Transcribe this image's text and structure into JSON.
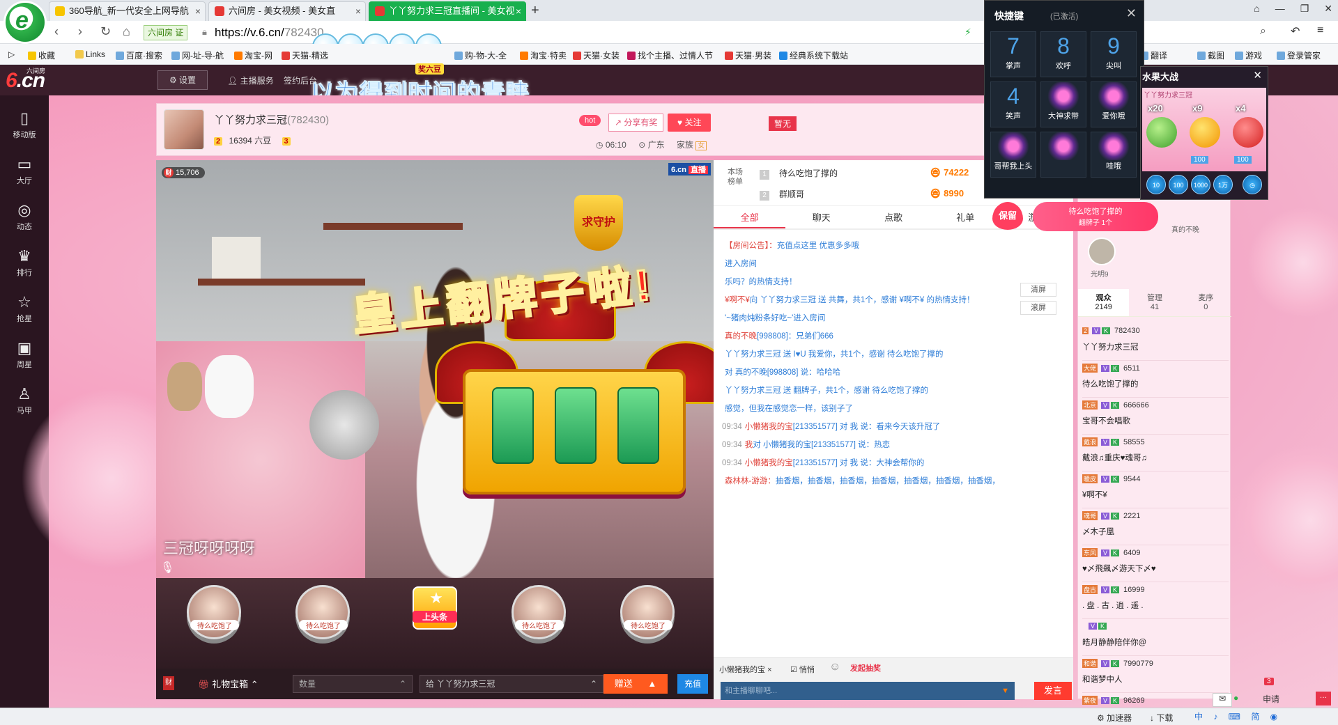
{
  "browser": {
    "tabs": [
      {
        "title": "360导航_新一代安全上网导航",
        "color": "#f7c500"
      },
      {
        "title": "六间房 - 美女视频 - 美女直",
        "color": "#e53935"
      },
      {
        "title": "丫丫努力求三冠直播间 - 美女视",
        "color": "#e53935"
      }
    ],
    "site_badge": "六间房 证",
    "url_host": "https://v.6.cn/",
    "url_path": "782430",
    "bookmarks": [
      "收藏",
      "Links",
      "百度·搜索",
      "网-址-导-航",
      "淘宝-网",
      "天猫-精选",
      "购-物-大-全",
      "淘宝·特卖",
      "天猫·女装",
      "找个主播、过情人节",
      "天猫·男装",
      "经典系统下载站",
      "翻译",
      "截图",
      "游戏",
      "登录管家"
    ]
  },
  "site": {
    "brand_sub": "六间房",
    "brand": "6.cn",
    "settings": "设置",
    "links": [
      "主播服务",
      "签约后台"
    ],
    "caption": "以为得到时间的青睐",
    "prize_badge": "奖六豆"
  },
  "leftnav": [
    {
      "icon": "phone-icon",
      "glyph": "▯",
      "label": "移动版"
    },
    {
      "icon": "tv-icon",
      "glyph": "▭",
      "label": "大厅"
    },
    {
      "icon": "compass-icon",
      "glyph": "◎",
      "label": "动态"
    },
    {
      "icon": "crown-icon",
      "glyph": "♛",
      "label": "排行"
    },
    {
      "icon": "star-icon",
      "glyph": "☆",
      "label": "抢星"
    },
    {
      "icon": "calendar-icon",
      "glyph": "▣",
      "label": "周星"
    },
    {
      "icon": "shirt-icon",
      "glyph": "♙",
      "label": "马甲"
    }
  ],
  "room": {
    "name": "丫丫努力求三冠",
    "id": "(782430)",
    "level_a": "2",
    "beans": "16394 六豆",
    "level_b": "3",
    "hot": "hot",
    "share": "分享有奖",
    "follow": "关注",
    "time": "06:10",
    "region": "广东",
    "family": "家族",
    "family_tag": "女",
    "noflag": "暂无"
  },
  "video": {
    "fans": "15,706",
    "fans_icon": "财",
    "logo": "6.cn",
    "live": "直播",
    "overlay_title": "皇上翻牌子啦!",
    "guard_badge": "求守护",
    "caption": "三冠呀呀呀呀"
  },
  "giftstrip": {
    "heads": [
      "待么吃饱了",
      "待么吃饱了",
      "待么吃饱了",
      "待么吃饱了"
    ],
    "top_label": "上头条"
  },
  "controls": {
    "cai": "财",
    "giftbox": "礼物宝箱",
    "qty_placeholder": "数量",
    "target": "给 丫丫努力求三冠",
    "send": "赠送",
    "recharge": "充值"
  },
  "chat": {
    "rank_label": "本场榜单",
    "ranks": [
      {
        "num": "1",
        "name": "待么吃饱了撑的",
        "score": "74222"
      },
      {
        "num": "2",
        "name": "群顺哥",
        "score": "8990"
      }
    ],
    "tabs": [
      "全部",
      "聊天",
      "点歌",
      "礼单",
      "游戏"
    ],
    "clear": "清屏",
    "scroll": "滚屏",
    "messages": [
      {
        "t": "",
        "u": "【房间公告】：",
        "v": "充值点这里 优惠多多哦"
      },
      {
        "t": "",
        "u": "",
        "v": "进入房间"
      },
      {
        "t": "",
        "u": "",
        "v": "乐吗？的热情支持！"
      },
      {
        "t": "",
        "u": "¥啊不¥",
        "v": "向 丫丫努力求三冠 送 共舞，共1个，感谢 ¥啊不¥ 的热情支持！"
      },
      {
        "t": "",
        "u": "",
        "v": "'~猪肉炖粉条好吃~'进入房间"
      },
      {
        "t": "",
        "u": "真的不晚",
        "v": "[998808]：兄弟们666"
      },
      {
        "t": "",
        "u": "",
        "v": "丫丫努力求三冠 送 I♥U 我爱你，共1个，感谢 待么吃饱了撑的"
      },
      {
        "t": "",
        "u": "",
        "v": "对 真的不晚[998808] 说：哈哈哈"
      },
      {
        "t": "",
        "u": "",
        "v": "丫丫努力求三冠 送 翻牌子，共1个，感谢 待么吃饱了撑的"
      },
      {
        "t": "",
        "u": "",
        "v": "感觉，但我在感觉恋一样，该别子了"
      },
      {
        "t": "09:34",
        "u": "小懒猪我的宝",
        "v": "[213351577] 对 我 说：看来今天该升冠了"
      },
      {
        "t": "09:34",
        "u": "我",
        "v": "对 小懒猪我的宝[213351577] 说：热恋"
      },
      {
        "t": "09:34",
        "u": "小懒猪我的宝",
        "v": "[213351577] 对 我 说：大神会帮你的"
      },
      {
        "t": "",
        "u": "森林林-游游：",
        "v": "抽香烟，抽香烟，抽香烟，抽香烟，抽香烟，抽香烟，抽香烟，"
      }
    ],
    "whisper_to": "小懒猪我的宝",
    "private": "悄悄",
    "activity": "发起抽奖",
    "input_placeholder": "和主播聊聊吧...",
    "send": "发言"
  },
  "users": {
    "keep": "保留",
    "flip_line1": "待么吃饱了撑的",
    "flip_line2": "翻牌子 1个",
    "guest_a": "光明9",
    "guest_b": "真的不晚",
    "stats": [
      {
        "label": "观众",
        "value": "2149"
      },
      {
        "label": "管理",
        "value": "41"
      },
      {
        "label": "麦序",
        "value": "0"
      }
    ],
    "list": [
      {
        "id": "782430",
        "name": "丫丫努力求三冠",
        "tag": "2"
      },
      {
        "id": "6511",
        "name": "待么吃饱了撑的",
        "tag": "大佬"
      },
      {
        "id": "666666",
        "name": "宝哥不会唱歌",
        "tag": "北京"
      },
      {
        "id": "58555",
        "name": "戴浪♫重庆♥魂哥♫",
        "tag": "戴浪"
      },
      {
        "id": "9544",
        "name": "¥啊不¥",
        "tag": "暖皮"
      },
      {
        "id": "2221",
        "name": "〆木子凰",
        "tag": "魂哥"
      },
      {
        "id": "6409",
        "name": "♥〆飛飆〆游天下〆♥",
        "tag": "东风"
      },
      {
        "id": "16999",
        "name": ". 盘 . 古 . 逍 . 遥 .",
        "tag": "盘古"
      },
      {
        "id": "",
        "name": "皓月静静陪伴你@",
        "tag": ""
      },
      {
        "id": "7990779",
        "name": "和谐梦中人",
        "tag": "和谐"
      },
      {
        "id": "96269",
        "name": "〆鎏夏々飛飆彡彡",
        "tag": "紫夜"
      }
    ]
  },
  "shortcut": {
    "title": "快捷键",
    "sub": "(已激活)",
    "keys": [
      {
        "n": "7",
        "l": "掌声"
      },
      {
        "n": "8",
        "l": "欢呼"
      },
      {
        "n": "9",
        "l": "尖叫"
      },
      {
        "n": "4",
        "l": "笑声"
      },
      {
        "n": "",
        "l": "大神求带"
      },
      {
        "n": "",
        "l": "爱你哦"
      },
      {
        "n": "",
        "l": "哥帮我上头"
      },
      {
        "n": "",
        "l": ""
      },
      {
        "n": "",
        "l": "哇哦"
      }
    ]
  },
  "fruit": {
    "title": "水果大战",
    "mults": [
      "x20",
      "x9",
      "x4"
    ],
    "costs": [
      "100",
      "100"
    ],
    "coins": [
      "10",
      "100",
      "1000",
      "1万"
    ],
    "subtitle": "丫丫努力求三冠"
  },
  "statusbar": {
    "accelerator": "加速器",
    "download": "下载",
    "apply": "申请",
    "count": "3"
  }
}
